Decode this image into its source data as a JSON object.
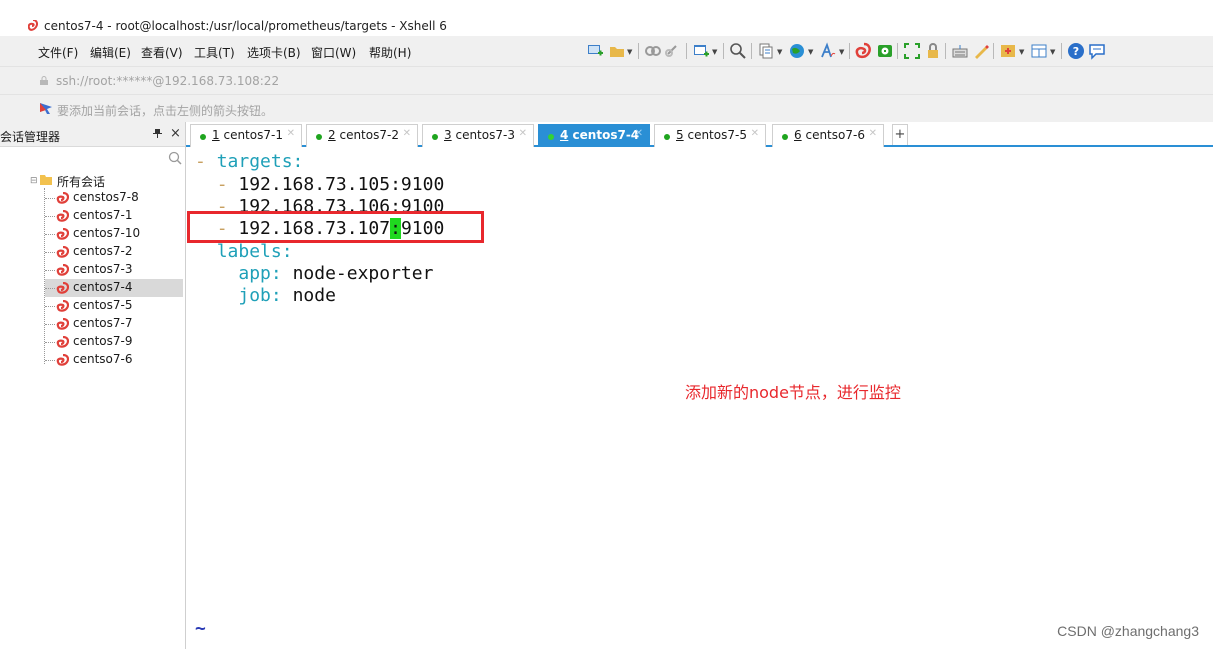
{
  "window": {
    "title": "centos7-4 - root@localhost:/usr/local/prometheus/targets - Xshell 6"
  },
  "menu": {
    "items": [
      "文件(F)",
      "编辑(E)",
      "查看(V)",
      "工具(T)",
      "选项卡(B)",
      "窗口(W)",
      "帮助(H)"
    ]
  },
  "address": {
    "text": "ssh://root:******@192.168.73.108:22"
  },
  "hint": {
    "text": "要添加当前会话，点击左侧的箭头按钮。"
  },
  "session_panel": {
    "title": "会话管理器",
    "pin": "ᵩ",
    "close": "×",
    "root_label": "所有会话",
    "sessions": [
      "censtos7-8",
      "centos7-1",
      "centos7-10",
      "centos7-2",
      "centos7-3",
      "centos7-4",
      "centos7-5",
      "centos7-7",
      "centos7-9",
      "centso7-6"
    ],
    "selected": "centos7-4"
  },
  "tabs": [
    {
      "num": "1",
      "name": "centos7-1"
    },
    {
      "num": "2",
      "name": "centos7-2"
    },
    {
      "num": "3",
      "name": "centos7-3"
    },
    {
      "num": "4",
      "name": "centos7-4"
    },
    {
      "num": "5",
      "name": "centos7-5"
    },
    {
      "num": "6",
      "name": "centso7-6"
    }
  ],
  "active_tab": "4 centos7-4",
  "tab_add": "+",
  "terminal": {
    "dash": "-",
    "targets_key": "targets",
    "colon": ":",
    "target1": "192.168.73.105:9100",
    "target2": "192.168.73.106:9100",
    "target3_ip": "192.168.73.107",
    "target3_colon": ":",
    "target3_port": "9100",
    "labels_key": "labels",
    "app_key": "app",
    "app_val": "node-exporter",
    "job_key": "job",
    "job_val": "node",
    "tilde": "~"
  },
  "annotation": "添加新的node节点，进行监控",
  "watermark": "CSDN @zhangchang3",
  "colors": {
    "accent": "#2a8fd5",
    "highlight": "#e8282d",
    "cursor": "#1fd81f",
    "yaml_key": "#1fa0b8"
  }
}
